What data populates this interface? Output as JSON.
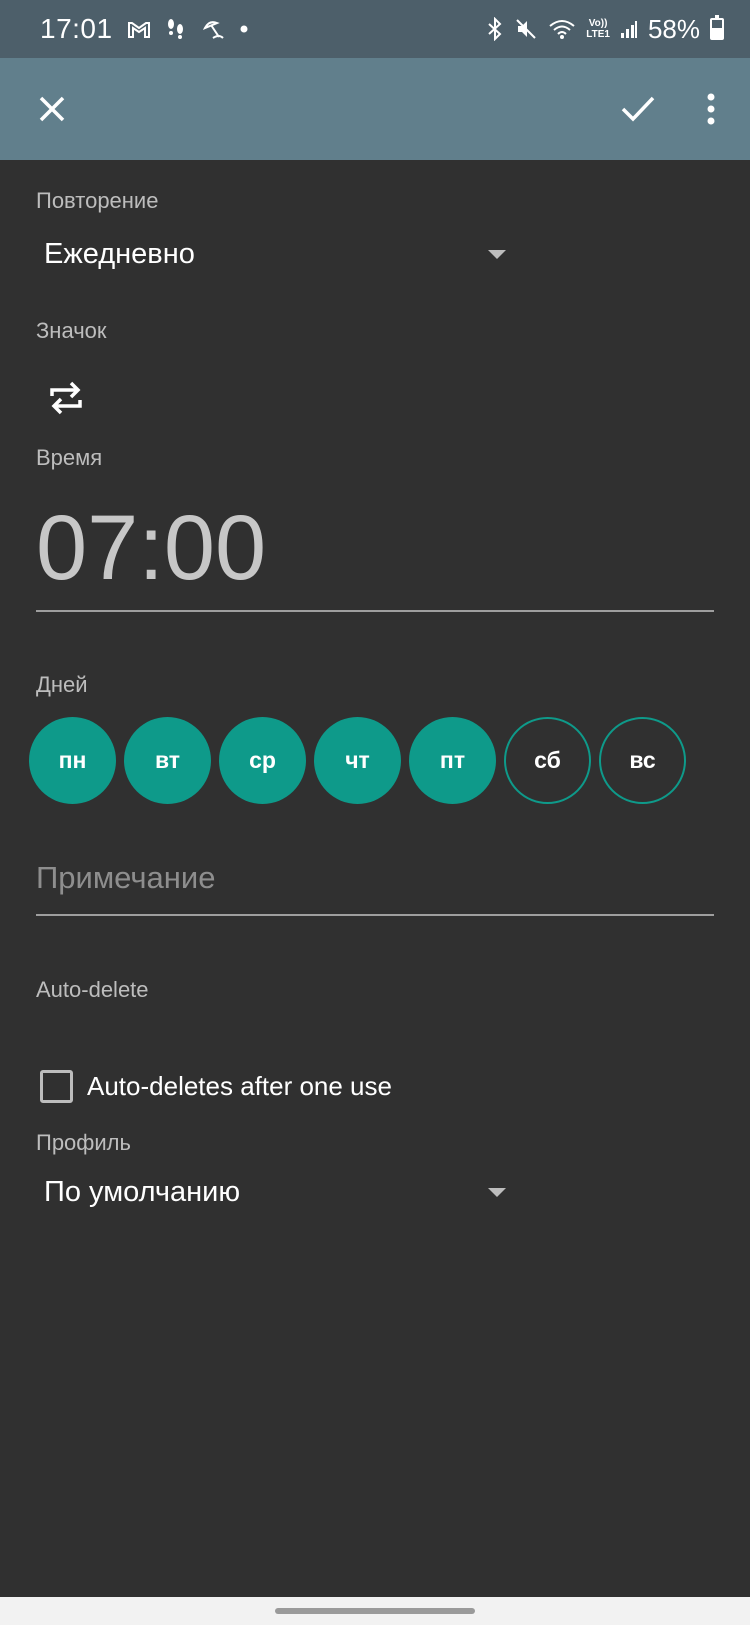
{
  "status_bar": {
    "time": "17:01",
    "left_icons": [
      "gmail-icon",
      "footsteps-icon",
      "beach-umbrella-icon",
      "dot-icon"
    ],
    "right_icons": [
      "bluetooth-icon",
      "mute-icon",
      "wifi-icon",
      "volte-lte-icon",
      "signal-icon"
    ],
    "volte_top": "Vo))",
    "volte_bottom": "LTE1",
    "battery_text": "58%",
    "battery_level": 0.58
  },
  "toolbar": {
    "close_icon": "close-icon",
    "confirm_icon": "check-icon",
    "more_icon": "more-vert-icon"
  },
  "form": {
    "repeat_label": "Повторение",
    "repeat_value": "Ежедневно",
    "icon_label": "Значок",
    "icon_value": "repeat-icon",
    "time_label": "Время",
    "time_value": "07:00",
    "days_label": "Дней",
    "days": [
      {
        "label": "пн",
        "selected": true
      },
      {
        "label": "вт",
        "selected": true
      },
      {
        "label": "ср",
        "selected": true
      },
      {
        "label": "чт",
        "selected": true
      },
      {
        "label": "пт",
        "selected": true
      },
      {
        "label": "сб",
        "selected": false
      },
      {
        "label": "вс",
        "selected": false
      }
    ],
    "note_placeholder": "Примечание",
    "autodelete_label": "Auto-delete",
    "autodelete_checkbox_label": "Auto-deletes after one use",
    "autodelete_checked": false,
    "profile_label": "Профиль",
    "profile_value": "По умолчанию"
  },
  "colors": {
    "background": "#303030",
    "toolbar": "#617f8c",
    "status_bar": "#4d5f6a",
    "accent": "#0e9a8a"
  }
}
